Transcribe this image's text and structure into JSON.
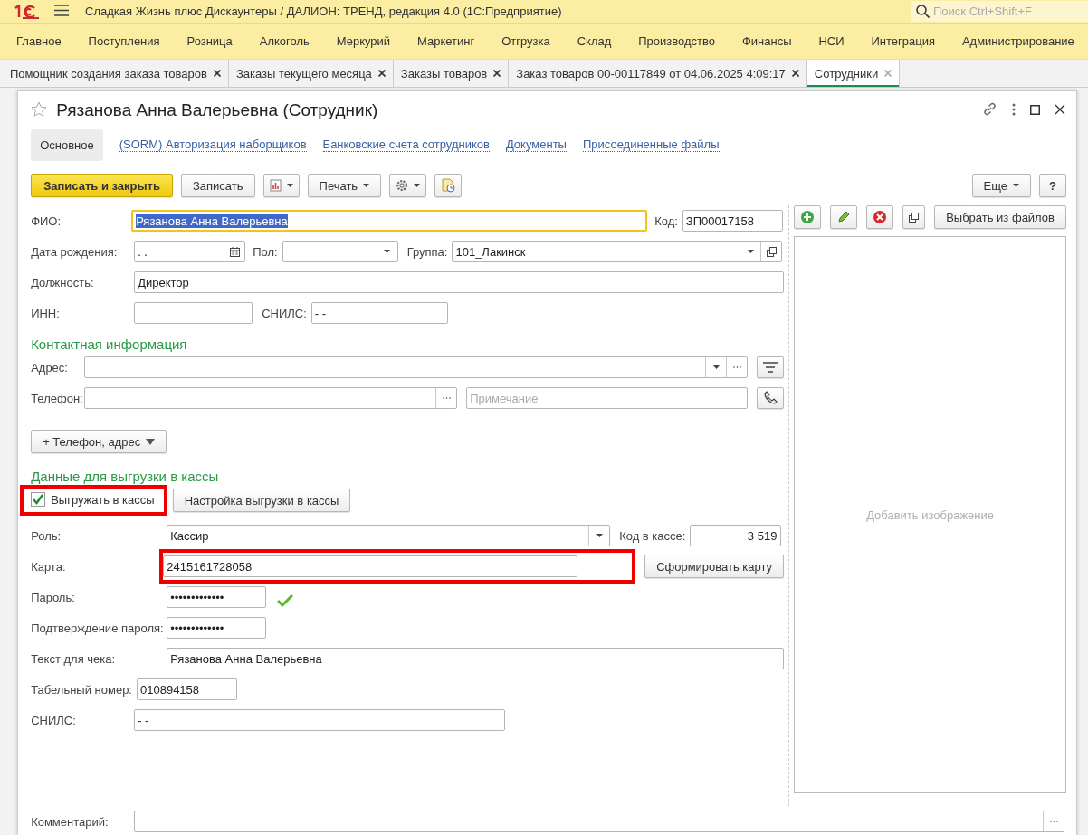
{
  "app": {
    "title": "Сладкая Жизнь плюс Дискаунтеры / ДАЛИОН: ТРЕНД, редакция 4.0  (1С:Предприятие)",
    "search_placeholder": "Поиск Ctrl+Shift+F"
  },
  "menu": [
    "Главное",
    "Поступления",
    "Розница",
    "Алкоголь",
    "Меркурий",
    "Маркетинг",
    "Отгрузка",
    "Склад",
    "Производство",
    "Финансы",
    "НСИ",
    "Интеграция",
    "Администрирование"
  ],
  "tabs": [
    {
      "label": "Помощник создания заказа товаров",
      "selected": false
    },
    {
      "label": "Заказы текущего месяца",
      "selected": false
    },
    {
      "label": "Заказы товаров",
      "selected": false
    },
    {
      "label": "Заказ товаров 00-00117849 от 04.06.2025 4:09:17",
      "selected": false
    },
    {
      "label": "Сотрудники",
      "selected": true
    }
  ],
  "form": {
    "title": "Рязанова Анна Валерьевна (Сотрудник)",
    "favorite": false,
    "sections": [
      {
        "label": "Основное",
        "selected": true
      },
      {
        "label": "(SORM) Авторизация наборщиков",
        "selected": false
      },
      {
        "label": "Банковские счета сотрудников",
        "selected": false
      },
      {
        "label": "Документы",
        "selected": false
      },
      {
        "label": "Присоединенные файлы",
        "selected": false
      }
    ],
    "toolbar": {
      "save_close": "Записать и закрыть",
      "save": "Записать",
      "print": "Печать",
      "more": "Еще",
      "help": "?"
    },
    "fio": {
      "label": "ФИО:",
      "value": "Рязанова Анна Валерьевна",
      "focused": true
    },
    "code": {
      "label": "Код:",
      "value": "ЗП00017158"
    },
    "birth_date": {
      "label": "Дата рождения:",
      "value": ".  ."
    },
    "gender": {
      "label": "Пол:"
    },
    "group": {
      "label": "Группа:",
      "value": "101_Лакинск"
    },
    "position": {
      "label": "Должность:",
      "value": "Директор"
    },
    "inn": {
      "label": "ИНН:"
    },
    "snils": {
      "label": "СНИЛС:",
      "value": "-   -"
    },
    "contact": {
      "heading": "Контактная информация",
      "address_label": "Адрес:",
      "phone_label": "Телефон:",
      "note_placeholder": "Примечание",
      "add_button": "+ Телефон, адрес"
    },
    "pos": {
      "heading": "Данные для выгрузки в кассы",
      "export": {
        "label": "Выгружать в кассы",
        "checked": true,
        "highlighted": true
      },
      "settings_button": "Настройка выгрузки в кассы",
      "role": {
        "label": "Роль:",
        "value": "Кассир"
      },
      "pos_code": {
        "label": "Код в кассе:",
        "value": "3 519"
      },
      "card": {
        "label": "Карта:",
        "value": "2415161728058",
        "highlighted": true
      },
      "card_button": "Сформировать карту",
      "password": {
        "label": "Пароль:",
        "value": "•••••••••••••",
        "valid": true
      },
      "password_confirm": {
        "label": "Подтверждение пароля:",
        "value": "•••••••••••••"
      },
      "receipt_text": {
        "label": "Текст для чека:",
        "value": "Рязанова Анна Валерьевна"
      },
      "personnel_number": {
        "label": "Табельный номер:",
        "value": "010894158"
      },
      "snils": {
        "label": "СНИЛС:",
        "value": "-   -"
      }
    },
    "image": {
      "choose_button": "Выбрать из файлов",
      "placeholder": "Добавить изображение"
    },
    "comment": {
      "label": "Комментарий:"
    }
  }
}
